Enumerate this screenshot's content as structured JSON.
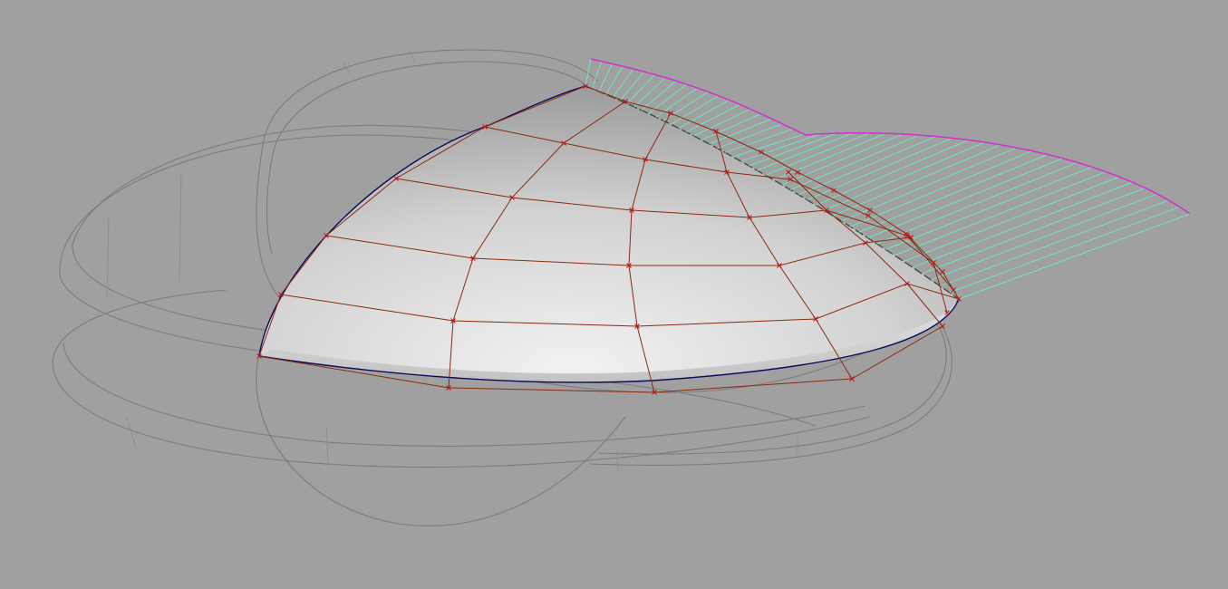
{
  "viewport": {
    "background": "#a0a0a0",
    "surface_shade_light": "#ececec",
    "surface_shade_dark": "#8a8a8a",
    "wireframe_color": "#7c7c7c",
    "control_net_color": "#8a2a10",
    "control_point_color": "#c01010",
    "curvature_comb_color": "#6fe6c0",
    "curvature_envelope_color": "#d030d0",
    "surface_edge_color": "#0a0a5a"
  }
}
